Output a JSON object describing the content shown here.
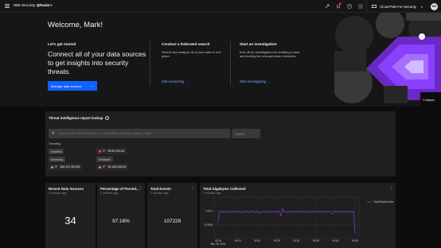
{
  "topbar": {
    "brand_prefix": "IBM Security",
    "brand_product": "QRadar+",
    "icons": [
      "switcher-icon",
      "notification-icon",
      "help-icon",
      "app-menu-icon"
    ],
    "tenant": "Cloud-Pak-For-Security",
    "avatar_initials": "MS"
  },
  "hero": {
    "welcome": "Welcome, Mark!",
    "getting_started": {
      "heading": "Let's get started",
      "text": "Connect all of your data sources to get insights into security threats.",
      "button_label": "Manage data sources"
    },
    "federated": {
      "heading": "Conduct a federated search",
      "text": "Search and analyze all of your data in one place.",
      "link": "Start searching"
    },
    "investigation": {
      "heading": "Start an investigation",
      "text": "Kick off an investigation by creating a case and inviting the relevant team members.",
      "link": "Start investigating"
    },
    "collapse_label": "Collapse"
  },
  "threat_intel": {
    "title": "Threat intelligence report lookup",
    "search_placeholder": "Search for IPs, URLs, file hashes, vulnerabilities, threats, malware, #Tags...",
    "search_button": "Search",
    "trending_label": "Trending",
    "tags": [
      "#ducktail",
      "#smishing",
      "#malware"
    ],
    "iocs": [
      {
        "type": "IP",
        "value": "45.81.243.34",
        "color": "#fa4d56"
      },
      {
        "type": "IP",
        "value": "180.147.96.203",
        "color": "#ff832b"
      },
      {
        "type": "IP",
        "value": "45.145.248.50",
        "color": "#ff832b"
      }
    ]
  },
  "cards": [
    {
      "title": "Recent Data Sources",
      "subtitle": "2 minutes ago",
      "value": "34"
    },
    {
      "title": "Percentage of Parsed...",
      "subtitle": "2 minutes ago",
      "value": "97.16%"
    },
    {
      "title": "Total Events",
      "subtitle": "2 minutes ago",
      "value": "107228"
    }
  ],
  "colors": {
    "accent": "#0f62fe",
    "link": "#78a9ff",
    "series": "#8a3ffc",
    "background": "#0c0c0c",
    "panel": "#1f1f1f"
  },
  "chart_data": {
    "type": "line",
    "title": "Total Gigabytes Collected",
    "subtitle": "2 minutes ago",
    "ylim": [
      0,
      0.0015
    ],
    "y_ticks": [
      "0.001",
      "0.0005"
    ],
    "x_ticks": [
      "09:10\nMar 26, 2023",
      "09:15",
      "09:20",
      "09:25",
      "09:30",
      "09:35",
      "09:40",
      "09:45"
    ],
    "series": [
      {
        "name": "TotalGbytesCollec",
        "values": [
          0.0006,
          0.00098,
          0.00095,
          0.00097,
          0.00096,
          0.00098,
          0.00094,
          0.00097,
          0.00095,
          0.00098,
          0.00096,
          0.00097,
          0.00095,
          0.00098,
          0.00096,
          0.00094,
          0.00097,
          0.00096,
          0.00098,
          0.00095,
          0.00097,
          0.00096,
          0.00098,
          0.00094,
          0.00097,
          0.00095,
          0.00093,
          0.00096,
          0.00098,
          0.00097,
          0.00095,
          0.00096,
          0.00098,
          0.00094,
          0.00097,
          0.00095,
          0.00096,
          0.00098,
          0.00097,
          0.00082,
          0.00108,
          0.00096,
          0.00097,
          0.00095,
          0.00098,
          0.00096,
          0.00097,
          0.00095,
          0.00096,
          0.00098,
          0.00097,
          0.00095,
          0.00096,
          0.00098,
          0.00094,
          0.00097,
          0.00096,
          0.00095,
          0.00098,
          0.00097,
          0.00096,
          0.00098,
          0.00095,
          0.00097,
          0.00096,
          0.00098,
          0.00097,
          0.00095,
          0.00096,
          0.00098,
          0.00097,
          0.00088,
          0.00096,
          0.00098,
          0.00097,
          0.00095,
          0.00096,
          0.00097,
          0.00095,
          0.00098,
          0.00096,
          0.00097,
          0.00095,
          0.00096,
          0.00097,
          0.0002
        ]
      }
    ]
  }
}
